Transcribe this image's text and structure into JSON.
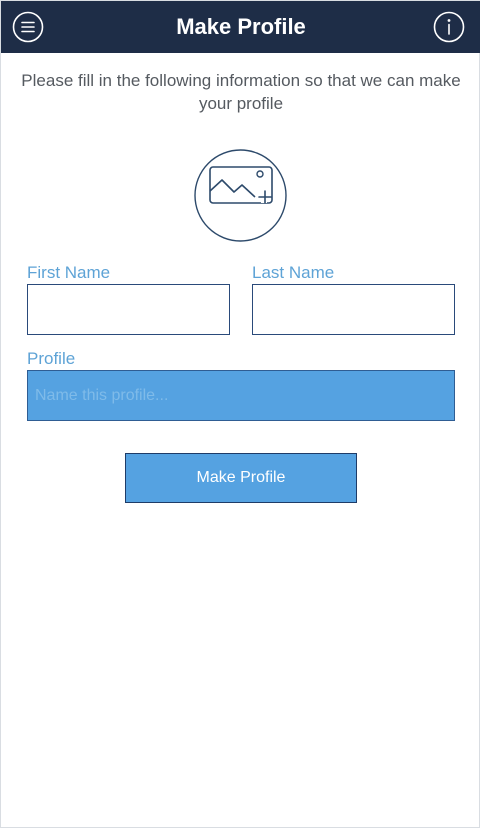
{
  "header": {
    "title": "Make Profile",
    "menu_icon": "menu-icon",
    "info_icon": "info-icon",
    "background_color": "#1e2d47"
  },
  "intro": {
    "text": "Please fill in the following information so that we can make your profile"
  },
  "avatar": {
    "icon": "add-photo-icon"
  },
  "form": {
    "first_name_label": "First Name",
    "first_name_value": "",
    "last_name_label": "Last Name",
    "last_name_value": "",
    "profile_label": "Profile",
    "profile_placeholder": "Name this profile...",
    "profile_value": "",
    "label_color": "#5ea3d6",
    "accent_color": "#55a2e1"
  },
  "submit": {
    "label": "Make Profile"
  }
}
